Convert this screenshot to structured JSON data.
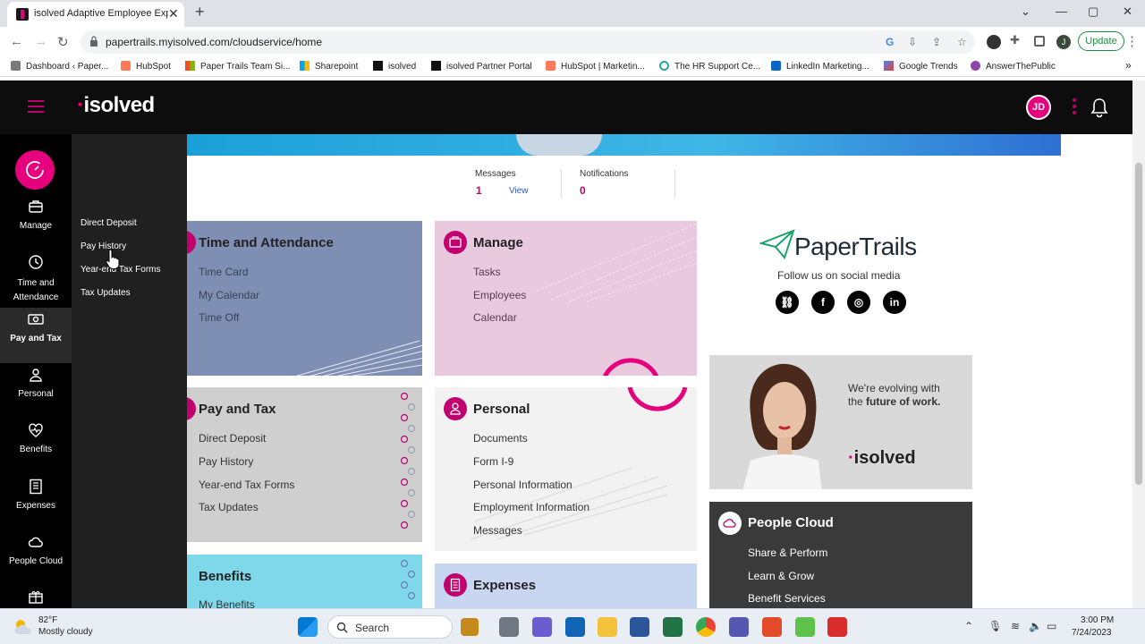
{
  "browser": {
    "tab_title": "isolved Adaptive Employee Experie...",
    "url": "papertrails.myisolved.com/cloudservice/home",
    "update_label": "Update",
    "profile_initial": "J",
    "bookmarks": [
      {
        "label": "Dashboard ‹ Paper...",
        "color": "#7a7a7a"
      },
      {
        "label": "HubSpot",
        "color": "#ff7a59"
      },
      {
        "label": "Paper Trails Team Si...",
        "color": "#f25022"
      },
      {
        "label": "Sharepoint",
        "color": "#00a4ef"
      },
      {
        "label": "isolved",
        "color": "#111111"
      },
      {
        "label": "isolved Partner Portal",
        "color": "#111111"
      },
      {
        "label": "HubSpot | Marketin...",
        "color": "#ff7a59"
      },
      {
        "label": "The HR Support Ce...",
        "color": "#2aa6a6"
      },
      {
        "label": "LinkedIn Marketing...",
        "color": "#0a66c2"
      },
      {
        "label": "Google Trends",
        "color": "#4285f4"
      },
      {
        "label": "AnswerThePublic",
        "color": "#8e44ad"
      }
    ]
  },
  "header": {
    "logo": "isolved",
    "avatar_initials": "JD"
  },
  "sidebar": {
    "items": [
      {
        "label": "Manage"
      },
      {
        "label": "Time and Attendance"
      },
      {
        "label": "Pay and Tax"
      },
      {
        "label": "Personal"
      },
      {
        "label": "Benefits"
      },
      {
        "label": "Expenses"
      },
      {
        "label": "People Cloud"
      }
    ],
    "flyout": [
      "Direct Deposit",
      "Pay History",
      "Year-end Tax Forms",
      "Tax Updates"
    ]
  },
  "stats": {
    "messages_label": "Messages",
    "messages_count": "1",
    "messages_link": "View",
    "notifications_label": "Notifications",
    "notifications_count": "0"
  },
  "tiles": {
    "time": {
      "title": "Time and Attendance",
      "items": [
        "Time Card",
        "My Calendar",
        "Time Off"
      ]
    },
    "manage": {
      "title": "Manage",
      "items": [
        "Tasks",
        "Employees",
        "Calendar"
      ]
    },
    "pay": {
      "title": "Pay and Tax",
      "items": [
        "Direct Deposit",
        "Pay History",
        "Year-end Tax Forms",
        "Tax Updates"
      ]
    },
    "personal": {
      "title": "Personal",
      "items": [
        "Documents",
        "Form I-9",
        "Personal Information",
        "Employment Information",
        "Messages"
      ]
    },
    "benefits": {
      "title": "Benefits",
      "items": [
        "My Benefits"
      ]
    },
    "expenses": {
      "title": "Expenses"
    },
    "people_cloud": {
      "title": "People Cloud",
      "items": [
        "Share & Perform",
        "Learn & Grow",
        "Benefit Services"
      ]
    }
  },
  "papertrails": {
    "logo_text": "PaperTrails",
    "follow": "Follow us on social media",
    "social": [
      "link-icon",
      "facebook-icon",
      "instagram-icon",
      "linkedin-icon"
    ]
  },
  "promo": {
    "line1": "We're evolving with",
    "line2_pre": "the ",
    "line2_bold": "future of work.",
    "logo": "isolved"
  },
  "taskbar": {
    "temp": "82°F",
    "weather": "Mostly cloudy",
    "search_label": "Search",
    "time": "3:00 PM",
    "date": "7/24/2023"
  },
  "colors": {
    "accent": "#e6007e",
    "accent_dark": "#c0006e",
    "time_tile": "#7f8fb3",
    "manage_tile": "#e9c9de",
    "pay_tile": "#cfcfcf",
    "personal_tile": "#f2f2f2",
    "benefits_tile": "#7fd8ea",
    "expenses_tile": "#c9d6f2"
  }
}
